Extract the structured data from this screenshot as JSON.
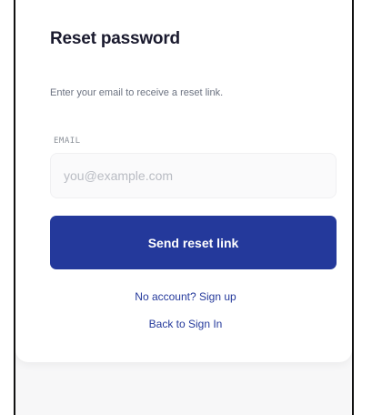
{
  "reset_card": {
    "title": "Reset password",
    "subtitle": "Enter your email to receive a reset link.",
    "email_label": "EMAIL",
    "email_placeholder": "you@example.com",
    "email_value": "",
    "submit_label": "Send reset link",
    "signup_link": "No account? Sign up",
    "back_link": "Back to Sign In"
  },
  "colors": {
    "accent": "#24399b",
    "title": "#1a1a2e",
    "muted_text": "#6b7280",
    "page_background": "#f7f7f8"
  }
}
